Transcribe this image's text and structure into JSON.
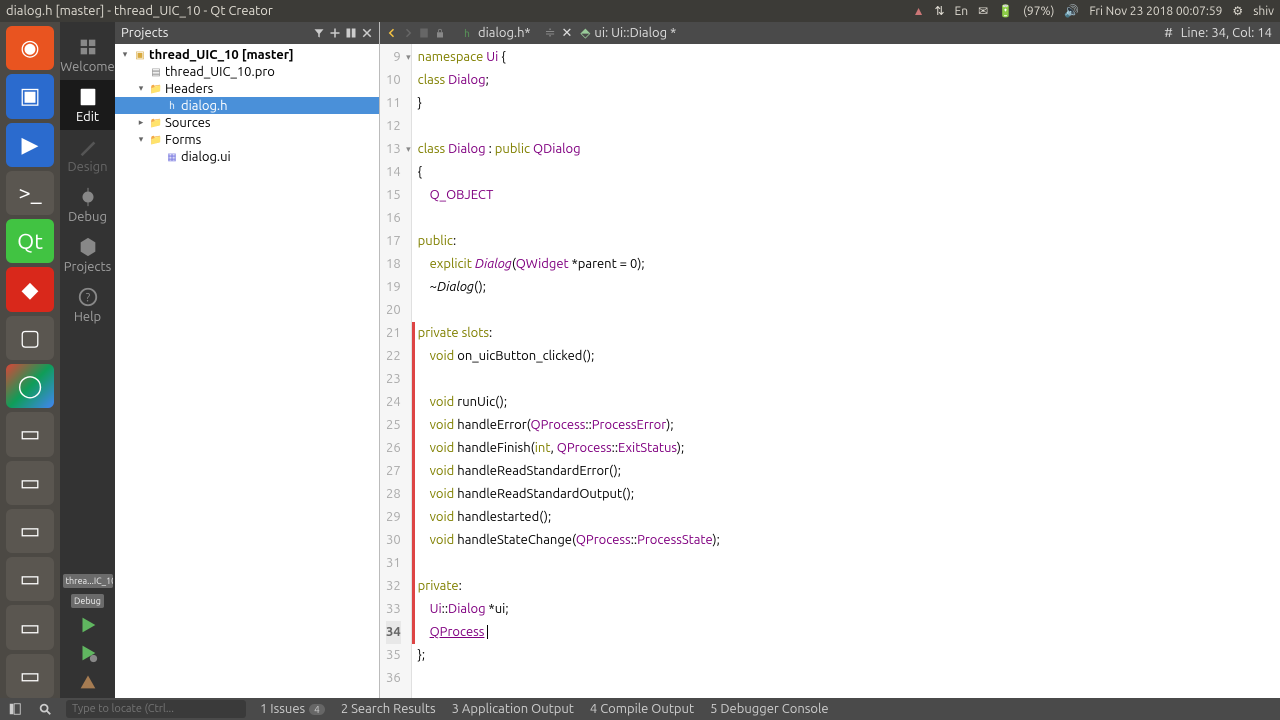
{
  "window_title": "dialog.h [master] - thread_UIC_10 - Qt Creator",
  "system_tray": {
    "battery": "(97%)",
    "time": "Fri Nov 23 2018 00:07:59",
    "user": "shiv",
    "lang": "En"
  },
  "projects_header": "Projects",
  "tree": {
    "root": "thread_UIC_10 [master]",
    "pro": "thread_UIC_10.pro",
    "headers": "Headers",
    "dialog_h": "dialog.h",
    "sources": "Sources",
    "forms": "Forms",
    "dialog_ui": "dialog.ui"
  },
  "mode": {
    "welcome": "Welcome",
    "edit": "Edit",
    "design": "Design",
    "debug": "Debug",
    "projects": "Projects",
    "help": "Help",
    "kit": "threa...IC_10",
    "debug2": "Debug"
  },
  "tabs": {
    "file1": "dialog.h*",
    "file2": "ui: Ui::Dialog *"
  },
  "cursor_info": {
    "hash": "#",
    "line": "Line: 34, Col: 14"
  },
  "code": [
    {
      "n": 9,
      "fold": true,
      "mod": false,
      "html": "<span class='kw'>n</span><span class='kw'>amespace</span> <span class='type'>Ui</span> <span class='op'>{</span>"
    },
    {
      "n": 10,
      "mod": false,
      "html": "<span class='kw'>class</span> <span class='type'>Dialog</span><span class='op'>;</span>"
    },
    {
      "n": 11,
      "mod": false,
      "html": "<span class='op'>}</span>"
    },
    {
      "n": 12,
      "mod": false,
      "html": ""
    },
    {
      "n": 13,
      "fold": true,
      "mod": false,
      "html": "<span class='kw'>class</span> <span class='type'>Dialog</span> <span class='op'>:</span> <span class='kw'>public</span> <span class='type'>QDialog</span>"
    },
    {
      "n": 14,
      "mod": false,
      "html": "<span class='op'>{</span>"
    },
    {
      "n": 15,
      "mod": false,
      "html": "    <span class='type'>Q_OBJECT</span>"
    },
    {
      "n": 16,
      "mod": false,
      "html": ""
    },
    {
      "n": 17,
      "mod": false,
      "html": "<span class='kw'>public</span><span class='op'>:</span>"
    },
    {
      "n": 18,
      "mod": false,
      "html": "    <span class='kw'>explicit</span> <span class='type func'>Dialog</span><span class='op'>(</span><span class='type'>QWidget</span> <span class='op'>*</span>parent <span class='op'>=</span> <span class='op'>0);</span>"
    },
    {
      "n": 19,
      "mod": false,
      "html": "    <span class='op'>~</span><span class='func'>Dialog</span><span class='op'>();</span>"
    },
    {
      "n": 20,
      "mod": false,
      "html": ""
    },
    {
      "n": 21,
      "mod": true,
      "html": "<span class='kw'>private</span> <span class='kw'>slots</span><span class='op'>:</span>"
    },
    {
      "n": 22,
      "mod": true,
      "html": "    <span class='kw'>void</span> <span class='id'>on_uicButton_clicked</span><span class='op'>();</span>"
    },
    {
      "n": 23,
      "mod": true,
      "html": ""
    },
    {
      "n": 24,
      "mod": true,
      "html": "    <span class='kw'>void</span> <span class='id'>runUic</span><span class='op'>();</span>"
    },
    {
      "n": 25,
      "mod": true,
      "html": "    <span class='kw'>void</span> <span class='id'>handleError</span><span class='op'>(</span><span class='type'>QProcess</span><span class='op'>::</span><span class='type'>ProcessError</span><span class='op'>);</span>"
    },
    {
      "n": 26,
      "mod": true,
      "html": "    <span class='kw'>void</span> <span class='id'>handleFinish</span><span class='op'>(</span><span class='kw'>int</span><span class='op'>,</span> <span class='type'>QProcess</span><span class='op'>::</span><span class='type'>ExitStatus</span><span class='op'>);</span>"
    },
    {
      "n": 27,
      "mod": true,
      "html": "    <span class='kw'>void</span> <span class='id'>handleReadStandardError</span><span class='op'>();</span>"
    },
    {
      "n": 28,
      "mod": true,
      "html": "    <span class='kw'>void</span> <span class='id'>handleReadStandardOutput</span><span class='op'>();</span>"
    },
    {
      "n": 29,
      "mod": true,
      "html": "    <span class='kw'>void</span> <span class='id'>handlestarted</span><span class='op'>();</span>"
    },
    {
      "n": 30,
      "mod": true,
      "html": "    <span class='kw'>void</span> <span class='id'>handleStateChange</span><span class='op'>(</span><span class='type'>QProcess</span><span class='op'>::</span><span class='type'>ProcessState</span><span class='op'>);</span>"
    },
    {
      "n": 31,
      "mod": true,
      "html": ""
    },
    {
      "n": 32,
      "mod": true,
      "html": "<span class='kw'>private</span><span class='op'>:</span>"
    },
    {
      "n": 33,
      "mod": true,
      "html": "    <span class='type'>Ui</span><span class='op'>::</span><span class='type'>Dialog</span> <span class='op'>*</span>ui<span class='op'>;</span>"
    },
    {
      "n": 34,
      "mod": true,
      "current": true,
      "html": "    <span class='type under'>QProcess</span> <span class='cursor'></span>"
    },
    {
      "n": 35,
      "mod": false,
      "html": "<span class='op'>};</span>"
    },
    {
      "n": 36,
      "mod": false,
      "html": ""
    }
  ],
  "status": {
    "search_placeholder": "Type to locate (Ctrl...",
    "issues": "1  Issues",
    "issues_badge": "4",
    "search": "2  Search Results",
    "app": "3  Application Output",
    "compile": "4  Compile Output",
    "debugger": "5  Debugger Console"
  }
}
